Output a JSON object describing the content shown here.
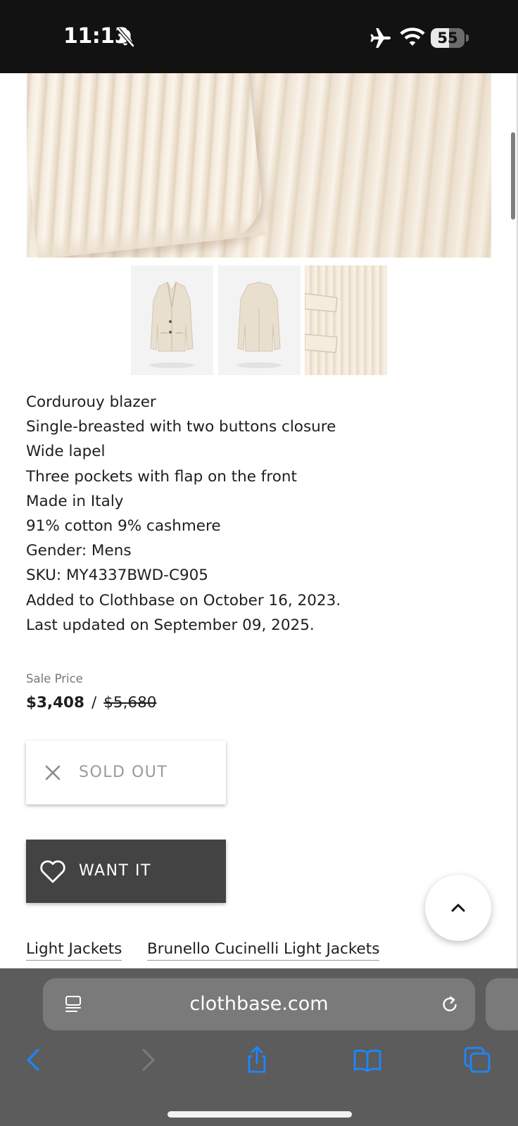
{
  "status_bar": {
    "time": "11:13",
    "battery": "55",
    "battery_level": 0.55
  },
  "product": {
    "description_lines": [
      "Cordurouy blazer",
      "Single-breasted with two buttons closure",
      "Wide lapel",
      "Three pockets with flap on the front",
      "Made in Italy",
      "91% cotton 9% cashmere",
      "Gender: Mens",
      "SKU: MY4337BWD-C905",
      "Added to Clothbase on October 16, 2023.",
      "Last updated on September 09, 2025."
    ],
    "price_label": "Sale Price",
    "sale_price": "$3,408",
    "price_separator": "/",
    "original_price": "$5,680"
  },
  "buttons": {
    "sold_out": "SOLD OUT",
    "want_it": "WANT IT"
  },
  "categories": [
    "Light Jackets",
    "Brunello Cucinelli Light Jackets"
  ],
  "browser": {
    "url": "clothbase.com"
  },
  "colors": {
    "status_bar_bg": "#121212",
    "want_it_bg": "#434343",
    "toolbar_bg": "#5c5c5c",
    "toolbar_icon_active": "#1e86ff",
    "sold_out_text": "#9a9a9a"
  },
  "icons": {
    "status": [
      "bell-slash-icon",
      "airplane-icon",
      "wifi-icon",
      "battery-icon"
    ],
    "toolbar": [
      "back-chevron-icon",
      "forward-chevron-icon",
      "share-icon",
      "bookmarks-icon",
      "tabs-icon"
    ]
  }
}
